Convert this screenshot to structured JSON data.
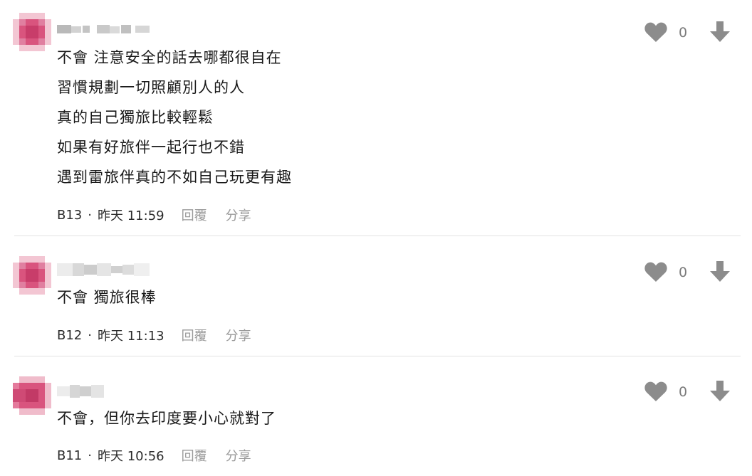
{
  "comments": [
    {
      "lines": [
        "不會 注意安全的話去哪都很自在",
        "習慣規劃一切照顧別人的人",
        "真的自己獨旅比較輕鬆",
        "如果有好旅伴一起行也不錯",
        "遇到雷旅伴真的不如自己玩更有趣"
      ],
      "floor": "B13",
      "separator": "·",
      "time": "昨天 11:59",
      "reply_label": "回覆",
      "share_label": "分享",
      "like_count": "0"
    },
    {
      "lines": [
        "不會 獨旅很棒"
      ],
      "floor": "B12",
      "separator": "·",
      "time": "昨天 11:13",
      "reply_label": "回覆",
      "share_label": "分享",
      "like_count": "0"
    },
    {
      "lines": [
        "不會，但你去印度要小心就對了"
      ],
      "floor": "B11",
      "separator": "·",
      "time": "昨天 10:56",
      "reply_label": "回覆",
      "share_label": "分享",
      "like_count": "0"
    }
  ],
  "colors": {
    "avatar_pink": "#d9547e",
    "icon_gray": "#8c8c8c",
    "action_gray": "#9a9a9a",
    "divider": "#e2e2e2"
  },
  "icons": {
    "avatar": "avatar-icon",
    "like": "heart-icon",
    "downvote": "arrow-down-icon"
  }
}
